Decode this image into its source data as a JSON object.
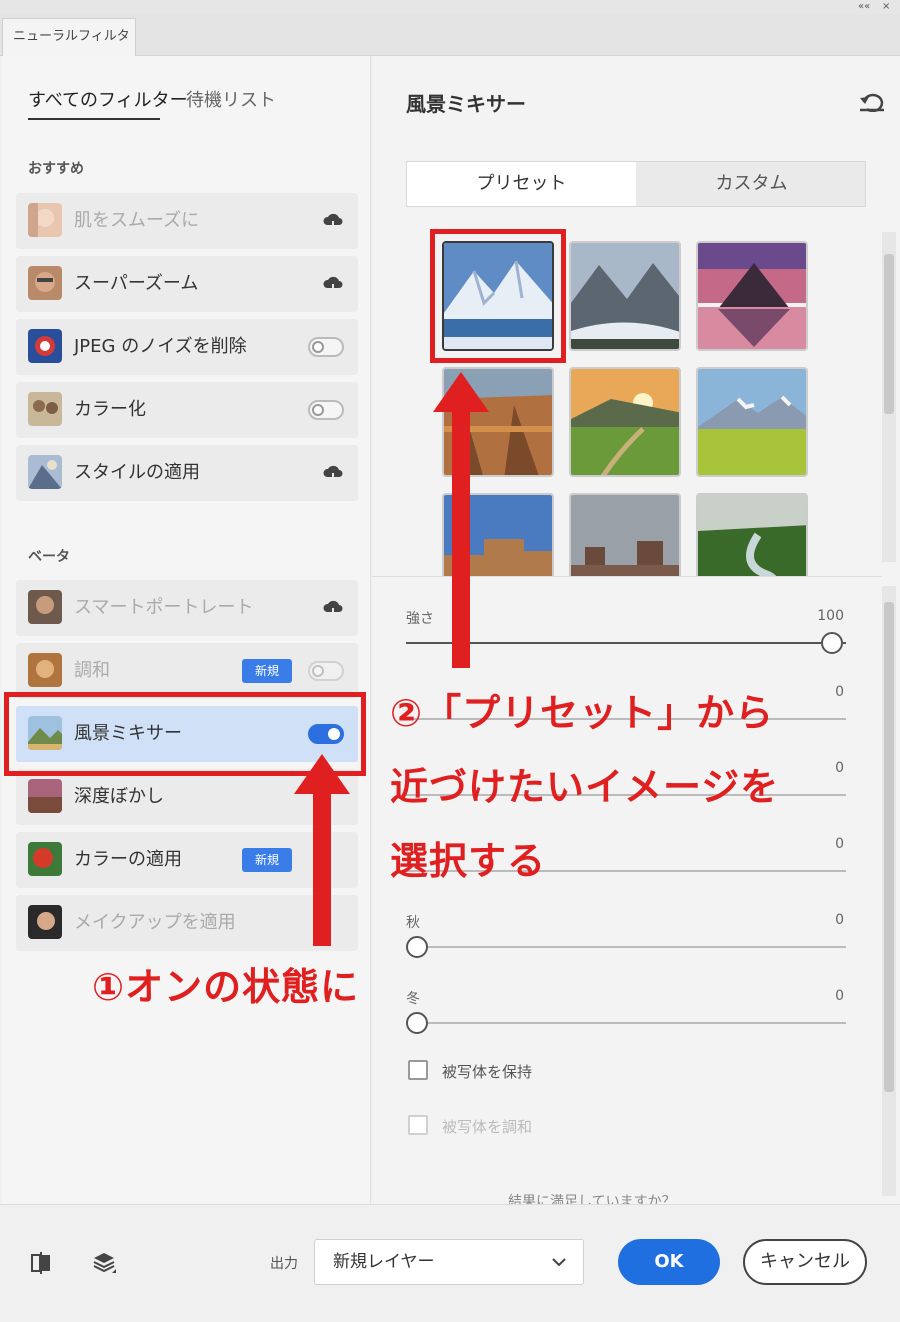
{
  "window": {
    "top_controls": [
      "««",
      "×"
    ]
  },
  "panel_tab": "ニューラルフィルター",
  "left_tabs": [
    {
      "label": "すべてのフィルター",
      "active": true
    },
    {
      "label": "待機リスト",
      "active": false
    }
  ],
  "sections": [
    {
      "title": "おすすめ",
      "items": [
        {
          "label": "肌をスムーズに",
          "control": "cloud",
          "dim": true
        },
        {
          "label": "スーパーズーム",
          "control": "cloud",
          "dim": false
        },
        {
          "label": "JPEG のノイズを削除",
          "control": "toggle-off",
          "dim": false
        },
        {
          "label": "カラー化",
          "control": "toggle-off",
          "dim": false
        },
        {
          "label": "スタイルの適用",
          "control": "cloud",
          "dim": false
        }
      ]
    },
    {
      "title": "ベータ",
      "items": [
        {
          "label": "スマートポートレート",
          "control": "cloud",
          "dim": true
        },
        {
          "label": "調和",
          "control": "toggle-off",
          "badge": "新規",
          "dim": true
        },
        {
          "label": "風景ミキサー",
          "control": "toggle-on",
          "dim": false,
          "selected": true
        },
        {
          "label": "深度ぼかし",
          "control": "cloud",
          "dim": false
        },
        {
          "label": "カラーの適用",
          "control": "toggle-off",
          "badge": "新規",
          "dim": false
        },
        {
          "label": "メイクアップを適用",
          "control": "cloud",
          "dim": true
        }
      ]
    }
  ],
  "right": {
    "title": "風景ミキサー",
    "segments": [
      "プリセット",
      "カスタム"
    ],
    "sliders": [
      {
        "label": "強さ",
        "value": "100"
      },
      {
        "label": "",
        "value": "0"
      },
      {
        "label": "",
        "value": "0"
      },
      {
        "label": "",
        "value": "0"
      },
      {
        "label": "秋",
        "value": "0"
      },
      {
        "label": "冬",
        "value": "0"
      }
    ],
    "checkboxes": [
      {
        "label": "被写体を保持",
        "dim": false
      },
      {
        "label": "被写体を調和",
        "dim": true
      }
    ],
    "bottom_text": "結果に満足していますか？"
  },
  "bottom": {
    "output_label": "出力",
    "output_value": "新規レイヤー",
    "ok": "OK",
    "cancel": "キャンセル"
  },
  "annotations": {
    "step1": "①オンの状態に",
    "step2_line1": "②「プリセット」から",
    "step2_line2": "近づけたいイメージを",
    "step2_line3": "選択する"
  },
  "colors": {
    "accent": "#1f6fe0",
    "annotation": "#e02020",
    "selected_row": "#cfe0f7",
    "badge": "#3b7de8"
  }
}
